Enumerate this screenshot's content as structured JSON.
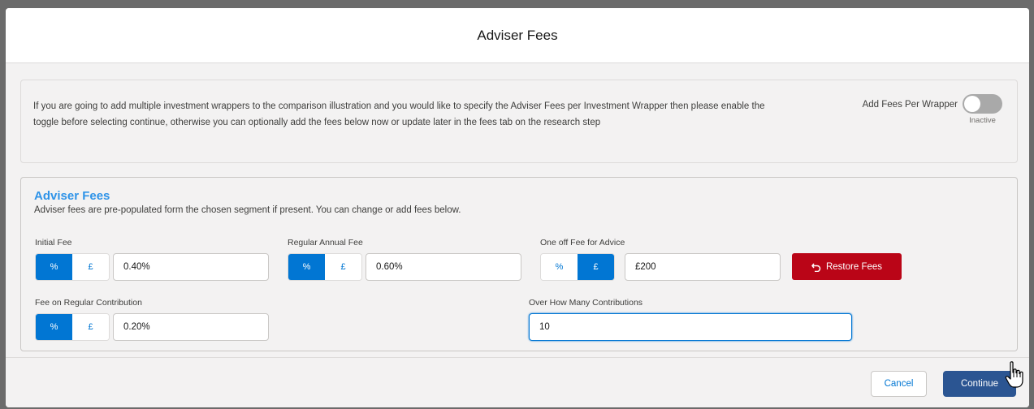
{
  "modal": {
    "title": "Adviser Fees"
  },
  "info": {
    "text": "If you are going to add multiple investment wrappers to the comparison illustration and you would like to specify the Adviser Fees per Investment Wrapper then please enable the toggle before selecting continue, otherwise you can optionally add the fees below now or update later in the fees tab on the research step",
    "toggle_label": "Add Fees Per Wrapper",
    "toggle_state": "Inactive",
    "toggle_on": false
  },
  "fees": {
    "title": "Adviser Fees",
    "subtitle": "Adviser fees are pre-populated form the chosen segment if present. You can change or add fees below.",
    "initial_fee": {
      "label": "Initial Fee",
      "percent_label": "%",
      "pound_label": "£",
      "selected": "%",
      "value": "0.40%"
    },
    "regular_annual_fee": {
      "label": "Regular Annual Fee",
      "percent_label": "%",
      "pound_label": "£",
      "selected": "%",
      "value": "0.60%"
    },
    "one_off_fee": {
      "label": "One off Fee for Advice",
      "percent_label": "%",
      "pound_label": "£",
      "selected": "£",
      "value": "£200"
    },
    "restore_label": "Restore Fees",
    "regular_contribution_fee": {
      "label": "Fee on Regular Contribution",
      "percent_label": "%",
      "pound_label": "£",
      "selected": "%",
      "value": "0.20%"
    },
    "contributions": {
      "label": "Over How Many Contributions",
      "value": "10"
    }
  },
  "footer": {
    "cancel_label": "Cancel",
    "continue_label": "Continue"
  },
  "colors": {
    "primary": "#0176d3",
    "title_blue": "#2e93e8",
    "restore_red": "#ba0517",
    "continue_navy": "#2b5592"
  },
  "icons": {
    "restore": "undo-arrow-icon",
    "cursor": "hand-pointer-icon"
  }
}
